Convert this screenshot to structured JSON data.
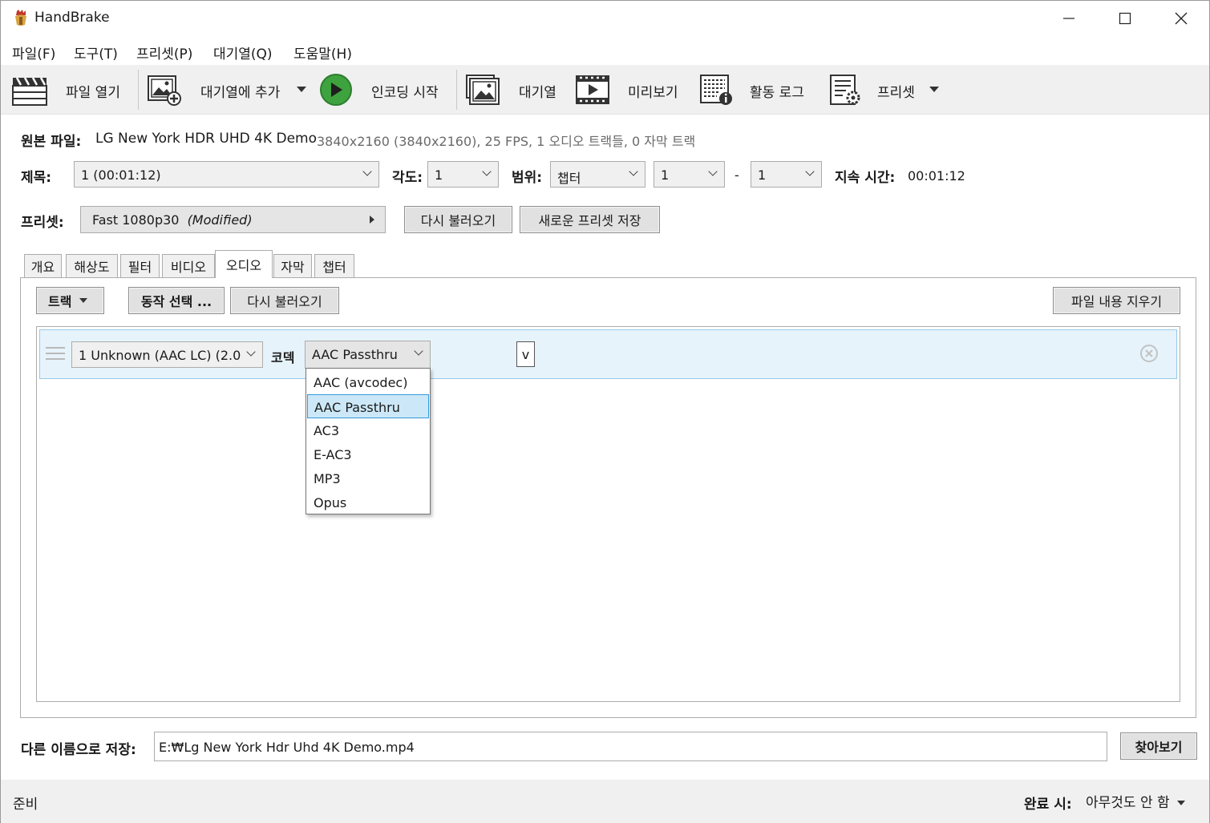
{
  "window": {
    "title": "HandBrake"
  },
  "menu": [
    "파일(F)",
    "도구(T)",
    "프리셋(P)",
    "대기열(Q)",
    "도움말(H)"
  ],
  "toolbar": {
    "open_source": "파일 열기",
    "add_to_queue": "대기열에 추가",
    "start_encode": "인코딩 시작",
    "queue": "대기열",
    "preview": "미리보기",
    "activity_log": "활동 로그",
    "presets": "프리셋"
  },
  "source": {
    "label": "원본 파일:",
    "name": "LG New York HDR UHD 4K Demo",
    "info": "3840x2160 (3840x2160), 25 FPS, 1 오디오 트랙들, 0 자막 트랙"
  },
  "title_row": {
    "title_label": "제목:",
    "title_value": "1  (00:01:12)",
    "angle_label": "각도:",
    "angle_value": "1",
    "range_label": "범위:",
    "range_type": "챕터",
    "range_start": "1",
    "range_dash": "-",
    "range_end": "1",
    "duration_label": "지속 시간:",
    "duration_value": "00:01:12"
  },
  "preset_row": {
    "label": "프리셋:",
    "name": "Fast 1080p30",
    "modified": "(Modified)",
    "reload_button": "다시 불러오기",
    "save_new_button": "새로운 프리셋 저장"
  },
  "tabs": [
    "개요",
    "해상도",
    "필터",
    "비디오",
    "오디오",
    "자막",
    "챕터"
  ],
  "active_tab": "오디오",
  "audio": {
    "tracks_button": "트랙",
    "behavior_button": "동작 선택 ...",
    "reload_button": "다시 불러오기",
    "clear_button": "파일 내용 지우기",
    "track": {
      "source": "1 Unknown (AAC LC) (2.0",
      "codec_label": "코덱",
      "codec_value": "AAC Passthru",
      "mini_value": "v"
    },
    "codec_options": [
      "AAC (avcodec)",
      "AAC Passthru",
      "AC3",
      "E-AC3",
      "MP3",
      "Opus"
    ],
    "selected_option": "AAC Passthru"
  },
  "save": {
    "label": "다른 이름으로 저장:",
    "path": "E:₩Lg New York Hdr Uhd 4K Demo.mp4",
    "browse_button": "찾아보기"
  },
  "status": {
    "text": "준비",
    "when_done_label": "완료 시:",
    "when_done_value": "아무것도 안 함"
  },
  "colors": {
    "play_green": "#3ea33e",
    "selection_blue": "#cce8f8",
    "track_row_bg": "#e6f3fb"
  }
}
